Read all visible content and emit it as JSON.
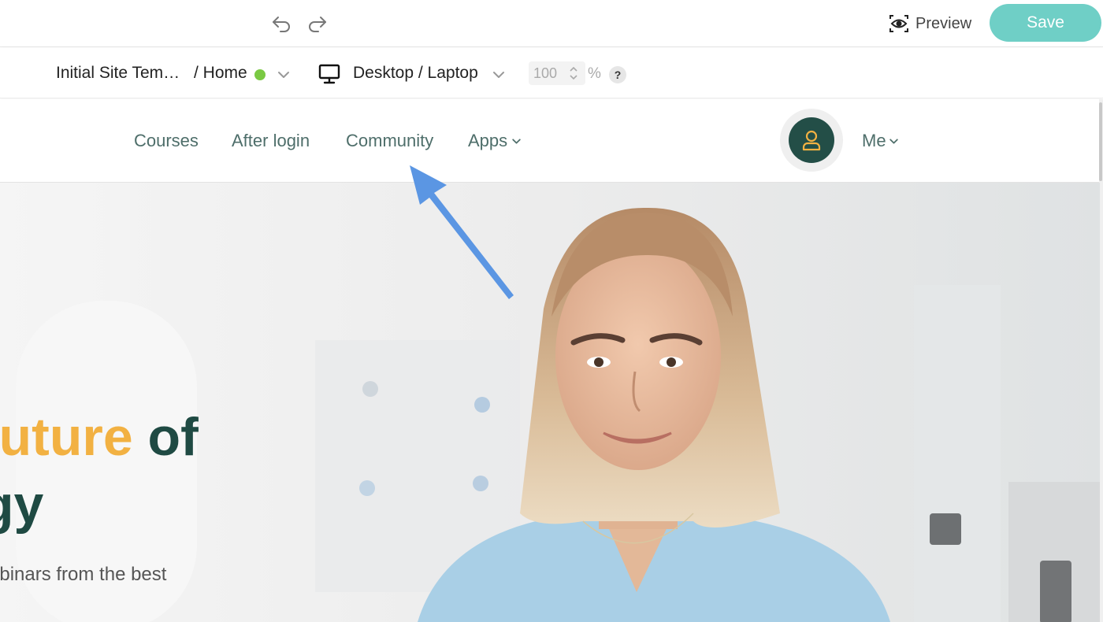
{
  "toolbar": {
    "undo_icon": "undo-icon",
    "redo_icon": "redo-icon",
    "preview_label": "Preview",
    "save_label": "Save"
  },
  "device_bar": {
    "site_name": "Initial Site Tem…",
    "page_name": "/ Home",
    "page_status_color": "#7ac943",
    "device_label": "Desktop / Laptop",
    "zoom_value": "100",
    "zoom_unit": "%",
    "help_label": "?"
  },
  "site_nav": {
    "links": [
      {
        "label": "Courses"
      },
      {
        "label": "After login"
      },
      {
        "label": "Community"
      },
      {
        "label": "Apps"
      }
    ],
    "account_label": "Me"
  },
  "hero": {
    "title_accent": "future",
    "title_rest": " of",
    "title_line2": "gy",
    "subtitle": "ebinars from the best"
  },
  "colors": {
    "save_button": "#6fcfc6",
    "nav_text": "#4e6e6a",
    "avatar_bg": "#234e47",
    "avatar_icon": "#f2b142",
    "heading": "#1f4a43",
    "heading_accent": "#f2b142",
    "annotation_arrow": "#5b96e3"
  }
}
